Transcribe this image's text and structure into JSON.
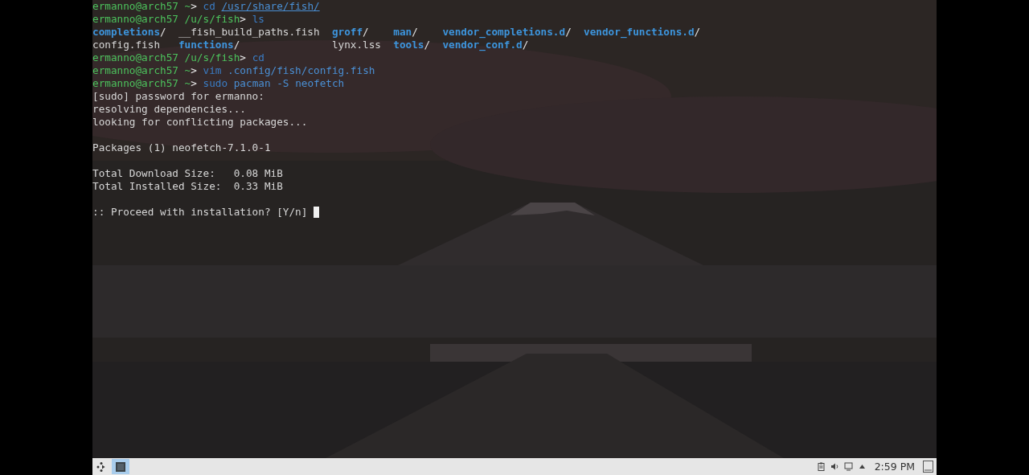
{
  "terminal": {
    "lines": [
      {
        "kind": "prompt",
        "user": "ermanno@arch57",
        "cwd": "~",
        "symbol": ">",
        "args": [
          {
            "text": "cd",
            "kind": "command"
          },
          {
            "text": "/usr/share/fish/",
            "kind": "path"
          }
        ]
      },
      {
        "kind": "prompt",
        "user": "ermanno@arch57",
        "cwd": "/u/s/fish",
        "symbol": ">",
        "args": [
          {
            "text": "ls",
            "kind": "command"
          }
        ]
      },
      {
        "kind": "listing",
        "entries": [
          {
            "text": "completions",
            "kind": "dir",
            "suffix": "/"
          },
          {
            "text": "config.fish",
            "kind": "file"
          },
          {
            "text": "__fish_build_paths.fish",
            "kind": "file"
          },
          {
            "text": "functions",
            "kind": "dir",
            "suffix": "/"
          },
          {
            "text": "groff",
            "kind": "dir",
            "suffix": "/"
          },
          {
            "text": "lynx.lss",
            "kind": "file"
          },
          {
            "text": "man",
            "kind": "dir",
            "suffix": "/"
          },
          {
            "text": "tools",
            "kind": "dir",
            "suffix": "/"
          },
          {
            "text": "vendor_completions.d",
            "kind": "dir",
            "suffix": "/"
          },
          {
            "text": "vendor_conf.d",
            "kind": "dir",
            "suffix": "/"
          },
          {
            "text": "vendor_functions.d",
            "kind": "dir",
            "suffix": "/"
          }
        ]
      },
      {
        "kind": "prompt",
        "user": "ermanno@arch57",
        "cwd": "/u/s/fish",
        "symbol": ">",
        "args": [
          {
            "text": "cd",
            "kind": "command"
          }
        ]
      },
      {
        "kind": "prompt",
        "user": "ermanno@arch57",
        "cwd": "~",
        "symbol": ">",
        "args": [
          {
            "text": "vim",
            "kind": "command"
          },
          {
            "text": ".config/fish/config.fish",
            "kind": "arg"
          }
        ]
      },
      {
        "kind": "prompt",
        "user": "ermanno@arch57",
        "cwd": "~",
        "symbol": ">",
        "args": [
          {
            "text": "sudo",
            "kind": "command"
          },
          {
            "text": "pacman",
            "kind": "arg"
          },
          {
            "text": "-S",
            "kind": "arg"
          },
          {
            "text": "neofetch",
            "kind": "arg"
          }
        ]
      },
      {
        "kind": "output",
        "text": "[sudo] password for ermanno:"
      },
      {
        "kind": "output",
        "text": "resolving dependencies..."
      },
      {
        "kind": "output",
        "text": "looking for conflicting packages..."
      },
      {
        "kind": "blank"
      },
      {
        "kind": "output",
        "text": "Packages (1) neofetch-7.1.0-1"
      },
      {
        "kind": "blank"
      },
      {
        "kind": "output",
        "text": "Total Download Size:   0.08 MiB"
      },
      {
        "kind": "output",
        "text": "Total Installed Size:  0.33 MiB"
      },
      {
        "kind": "blank"
      },
      {
        "kind": "output",
        "text": ":: Proceed with installation? [Y/n]",
        "cursor": true
      }
    ]
  },
  "taskbar": {
    "tasks": [
      {
        "kind": "terminal",
        "selected": true
      }
    ],
    "clock": "2:59 PM"
  }
}
